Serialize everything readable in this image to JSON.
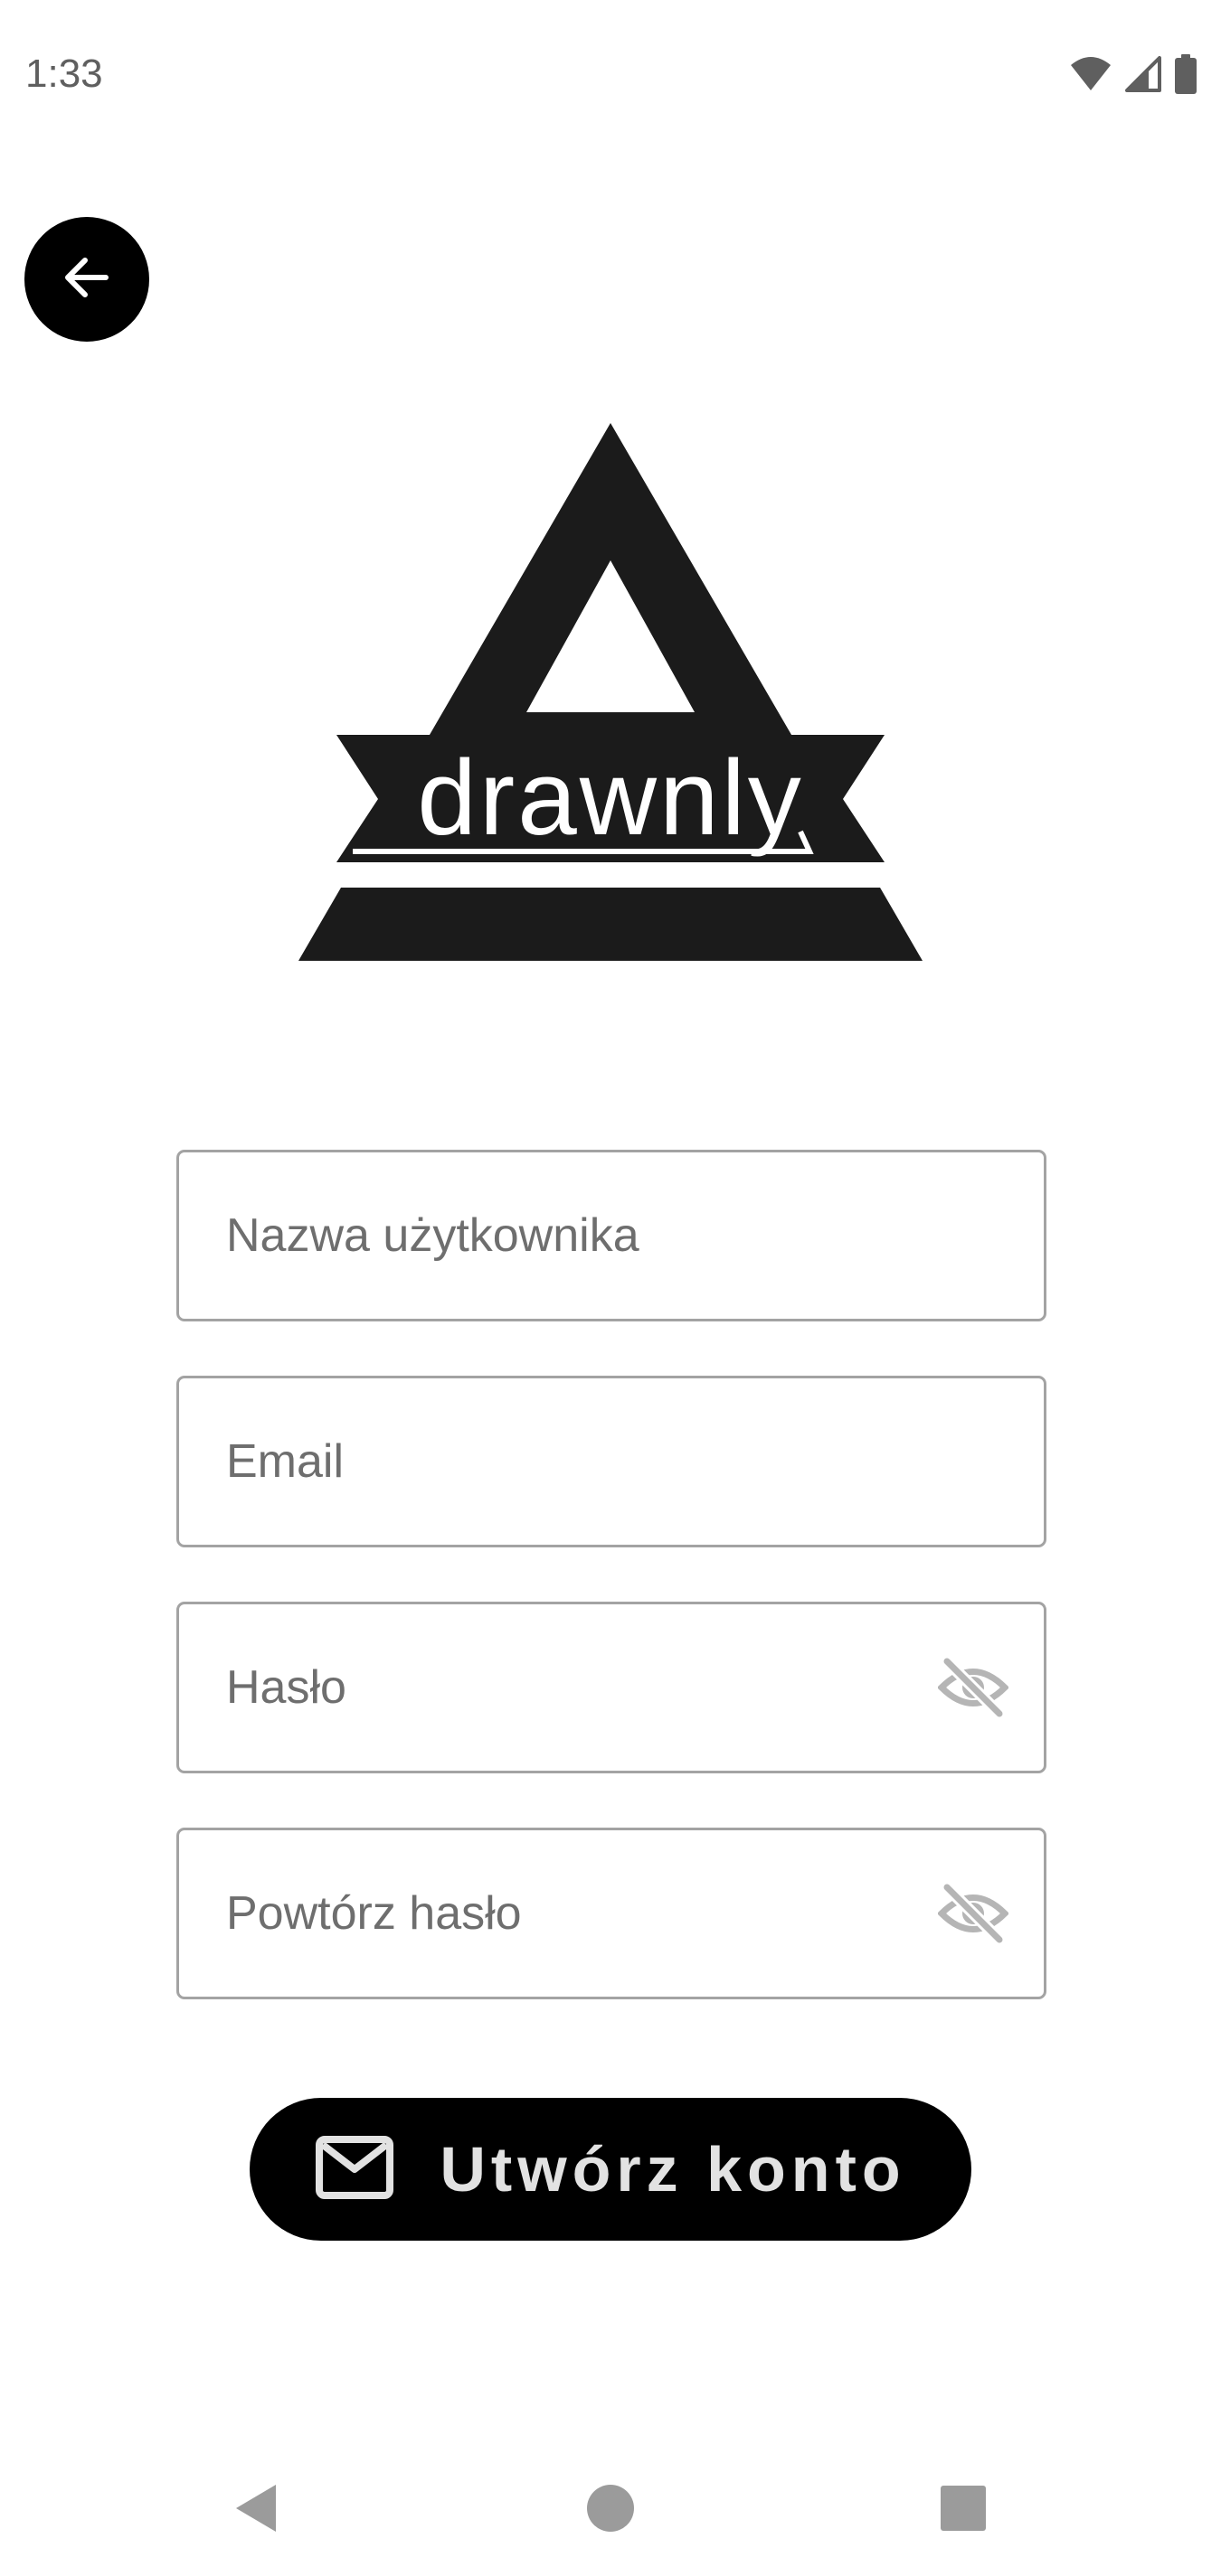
{
  "status_bar": {
    "time": "1:33",
    "icons": [
      "wifi-icon",
      "cellular-signal-icon",
      "battery-icon"
    ]
  },
  "header": {
    "back_icon": "arrow-left-icon"
  },
  "logo": {
    "text": "drawnly"
  },
  "form": {
    "username": {
      "placeholder": "Nazwa użytkownika",
      "value": ""
    },
    "email": {
      "placeholder": "Email",
      "value": ""
    },
    "password": {
      "placeholder": "Hasło",
      "value": "",
      "toggle_icon": "eye-off-icon"
    },
    "repeat_password": {
      "placeholder": "Powtórz hasło",
      "value": "",
      "toggle_icon": "eye-off-icon"
    }
  },
  "submit": {
    "label": "Utwórz konto",
    "icon": "mail-icon"
  },
  "nav_bar": {
    "items": [
      "back-triangle-icon",
      "home-circle-icon",
      "recents-square-icon"
    ]
  },
  "colors": {
    "primary": "#000000",
    "logo": "#1b1b1b",
    "field_border": "#a3a3a3",
    "button_text": "#e2e2e2",
    "nav_icon": "#9b9b9b"
  }
}
